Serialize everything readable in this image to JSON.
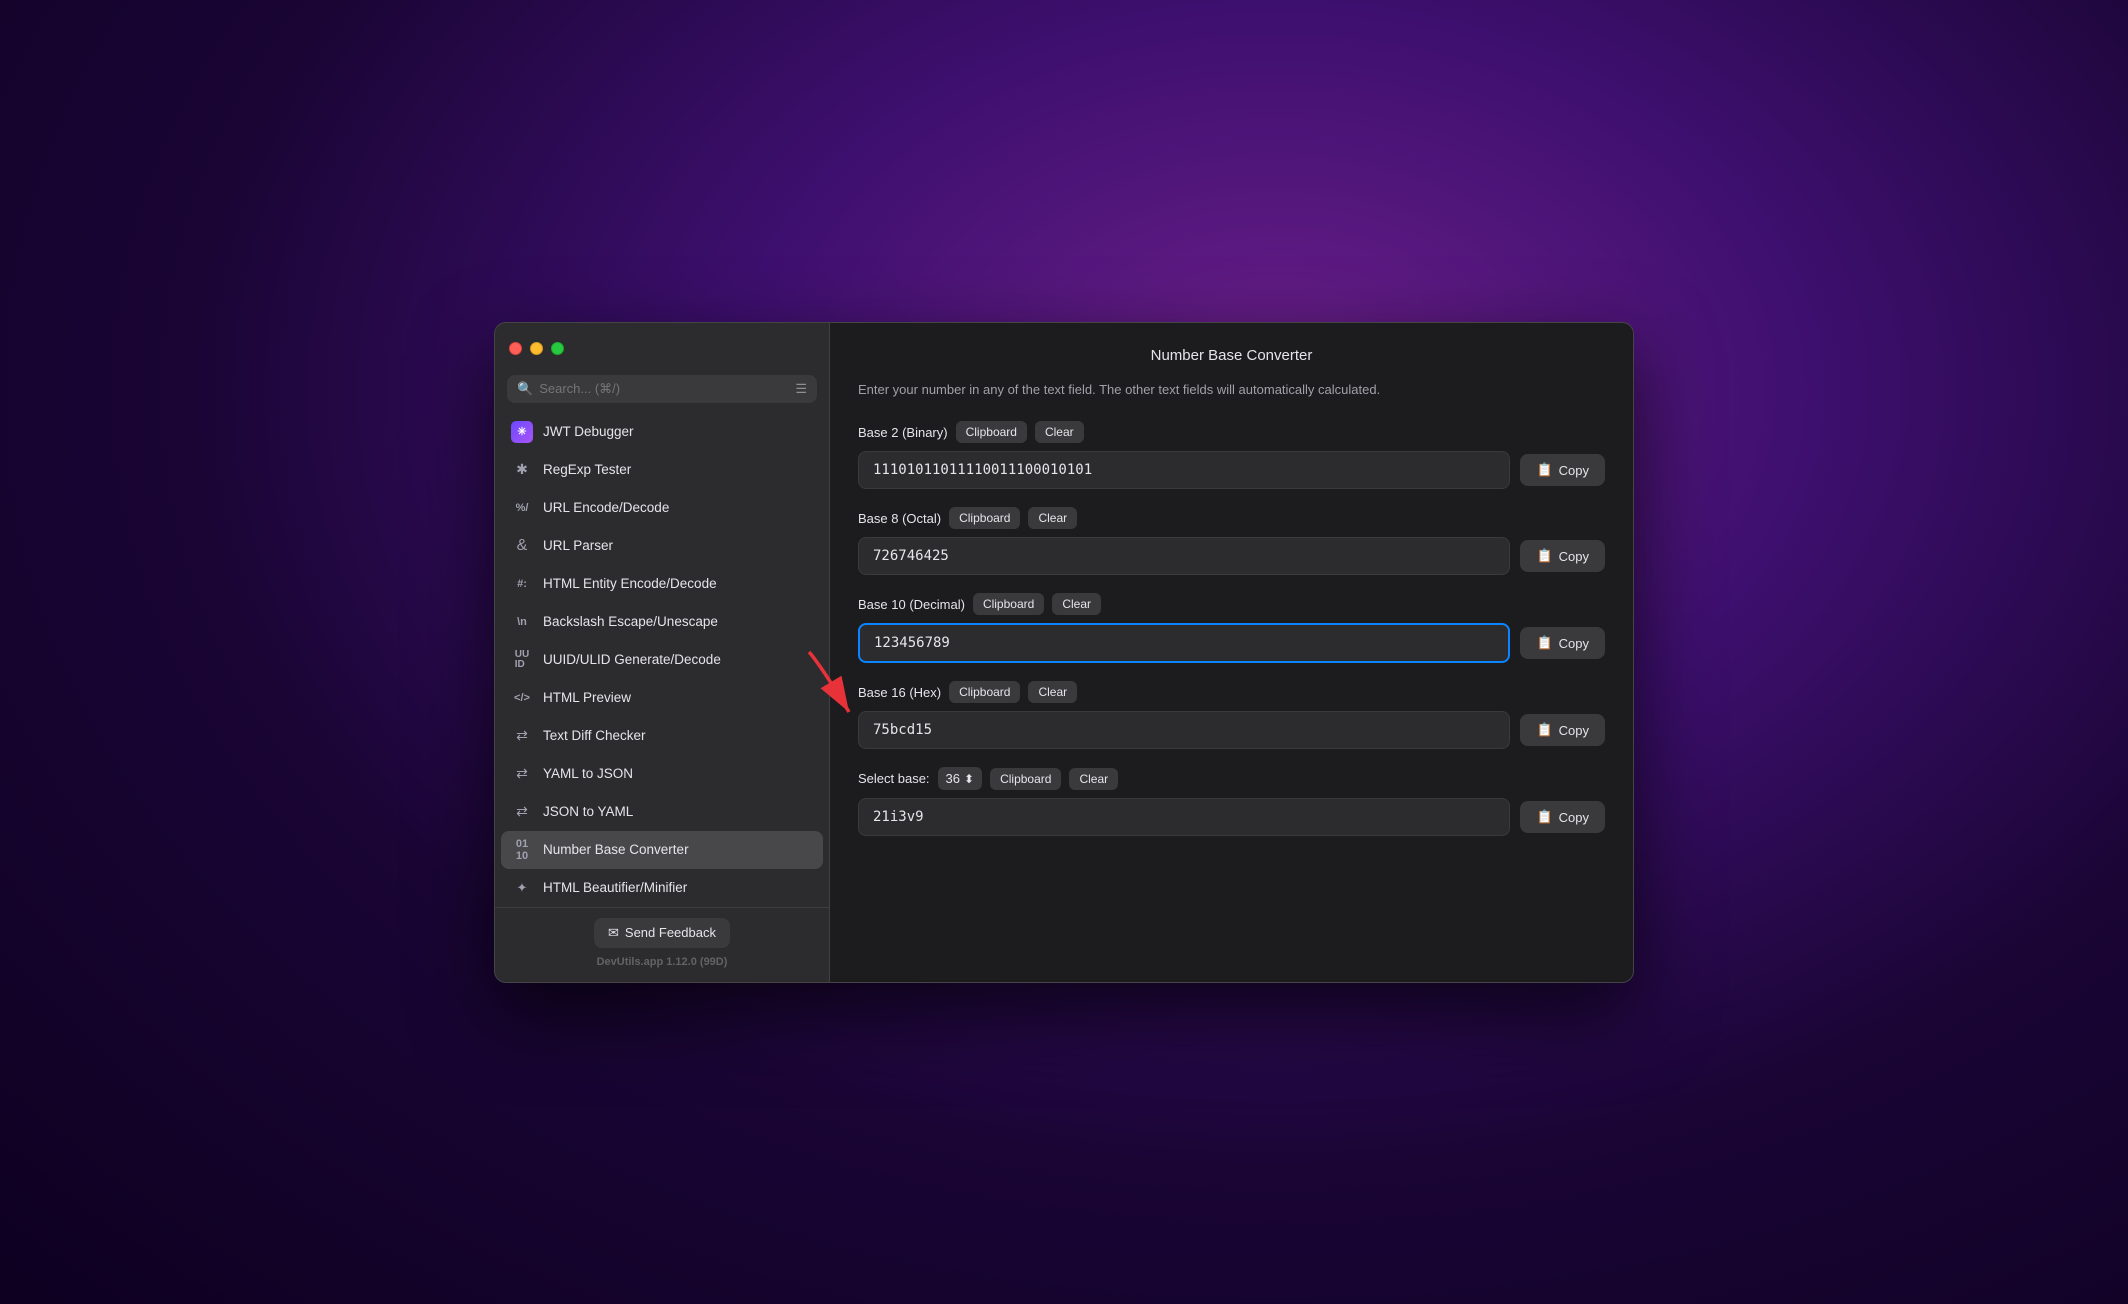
{
  "window": {
    "title": "Number Base Converter"
  },
  "sidebar": {
    "search_placeholder": "Search... (⌘/)",
    "items": [
      {
        "id": "jwt",
        "label": "JWT Debugger",
        "icon": "✳",
        "icon_type": "jwt"
      },
      {
        "id": "regexp",
        "label": "RegExp Tester",
        "icon": "✱",
        "icon_type": "symbol"
      },
      {
        "id": "url-encode",
        "label": "URL Encode/Decode",
        "icon": "%/",
        "icon_type": "symbol"
      },
      {
        "id": "url-parser",
        "label": "URL Parser",
        "icon": "⌥",
        "icon_type": "symbol"
      },
      {
        "id": "html-entity",
        "label": "HTML Entity Encode/Decode",
        "icon": "#:",
        "icon_type": "symbol"
      },
      {
        "id": "backslash",
        "label": "Backslash Escape/Unescape",
        "icon": "\\n",
        "icon_type": "symbol"
      },
      {
        "id": "uuid",
        "label": "UUID/ULID Generate/Decode",
        "icon": "UU",
        "icon_type": "symbol"
      },
      {
        "id": "html-preview",
        "label": "HTML Preview",
        "icon": "</>",
        "icon_type": "symbol"
      },
      {
        "id": "text-diff",
        "label": "Text Diff Checker",
        "icon": "⇄+",
        "icon_type": "symbol"
      },
      {
        "id": "yaml-json",
        "label": "YAML to JSON",
        "icon": "⇄",
        "icon_type": "symbol"
      },
      {
        "id": "json-yaml",
        "label": "JSON to YAML",
        "icon": "⇄",
        "icon_type": "symbol"
      },
      {
        "id": "number-base",
        "label": "Number Base Converter",
        "icon": "01",
        "icon_type": "symbol",
        "active": true
      },
      {
        "id": "html-beautify",
        "label": "HTML Beautifier/Minifier",
        "icon": "✦",
        "icon_type": "symbol"
      }
    ],
    "send_feedback_label": "Send Feedback",
    "version": "DevUtils.app 1.12.0 (99D)"
  },
  "main": {
    "title": "Number Base Converter",
    "description": "Enter your number in any of the text field. The other text fields will automatically calculated.",
    "sections": [
      {
        "id": "base2",
        "label": "Base 2 (Binary)",
        "clipboard_label": "Clipboard",
        "clear_label": "Clear",
        "value": "11101011011110011100010101",
        "copy_label": "Copy",
        "active": false
      },
      {
        "id": "base8",
        "label": "Base 8 (Octal)",
        "clipboard_label": "Clipboard",
        "clear_label": "Clear",
        "value": "726746425",
        "copy_label": "Copy",
        "active": false
      },
      {
        "id": "base10",
        "label": "Base 10 (Decimal)",
        "clipboard_label": "Clipboard",
        "clear_label": "Clear",
        "value": "123456789",
        "copy_label": "Copy",
        "active": true
      },
      {
        "id": "base16",
        "label": "Base 16 (Hex)",
        "clipboard_label": "Clipboard",
        "clear_label": "Clear",
        "value": "75bcd15",
        "copy_label": "Copy",
        "active": false
      },
      {
        "id": "base36",
        "label": "Select base:",
        "base_value": "36",
        "clipboard_label": "Clipboard",
        "clear_label": "Clear",
        "value": "21i3v9",
        "copy_label": "Copy",
        "active": false,
        "is_custom": true
      }
    ]
  }
}
